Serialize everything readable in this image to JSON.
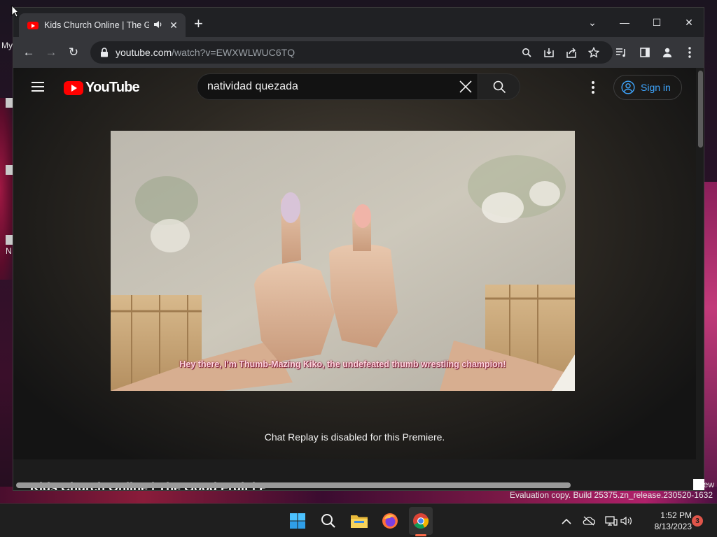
{
  "desktop": {
    "label_my": "My",
    "label_n": "N",
    "watermark": "Evaluation copy. Build 25375.zn_release.230520-1632",
    "watermark_fragment": "ew"
  },
  "browser": {
    "tab": {
      "title": "Kids Church Online | The Goo",
      "audio_icon": "speaker-icon",
      "close_label": "✕"
    },
    "new_tab_label": "+",
    "window_controls": {
      "tab_search": "⌄",
      "minimize": "—",
      "maximize": "☐",
      "close": "✕"
    },
    "nav": {
      "back": "←",
      "forward": "→",
      "reload": "↻"
    },
    "url": {
      "host": "youtube.com",
      "path": "/watch?v=EWXWLWUC6TQ"
    },
    "toolbar_icons": [
      "zoom-icon",
      "install-icon",
      "share-icon",
      "bookmark-star-icon",
      "reading-list-icon",
      "side-panel-icon",
      "profile-icon",
      "menu-icon"
    ]
  },
  "youtube": {
    "logo_text": "YouTube",
    "search": {
      "query": "natividad quezada"
    },
    "sign_in_label": "Sign in",
    "video": {
      "subtitle": "Hey there, I'm Thumb-Mazing Kiko, the undefeated thumb wrestling champion!"
    },
    "chat_replay": "Chat Replay is disabled for this Premiere.",
    "video_title_partial": "Kids Church Online | The Good Fruit | P"
  },
  "taskbar": {
    "apps": [
      "windows-start-icon",
      "search-icon",
      "file-explorer-icon",
      "firefox-icon",
      "chrome-icon"
    ],
    "tray": [
      "chevron-up-icon",
      "cloud-offline-icon",
      "network-icon",
      "volume-icon"
    ],
    "time": "1:52 PM",
    "date": "8/13/2023",
    "notification_count": "3"
  }
}
